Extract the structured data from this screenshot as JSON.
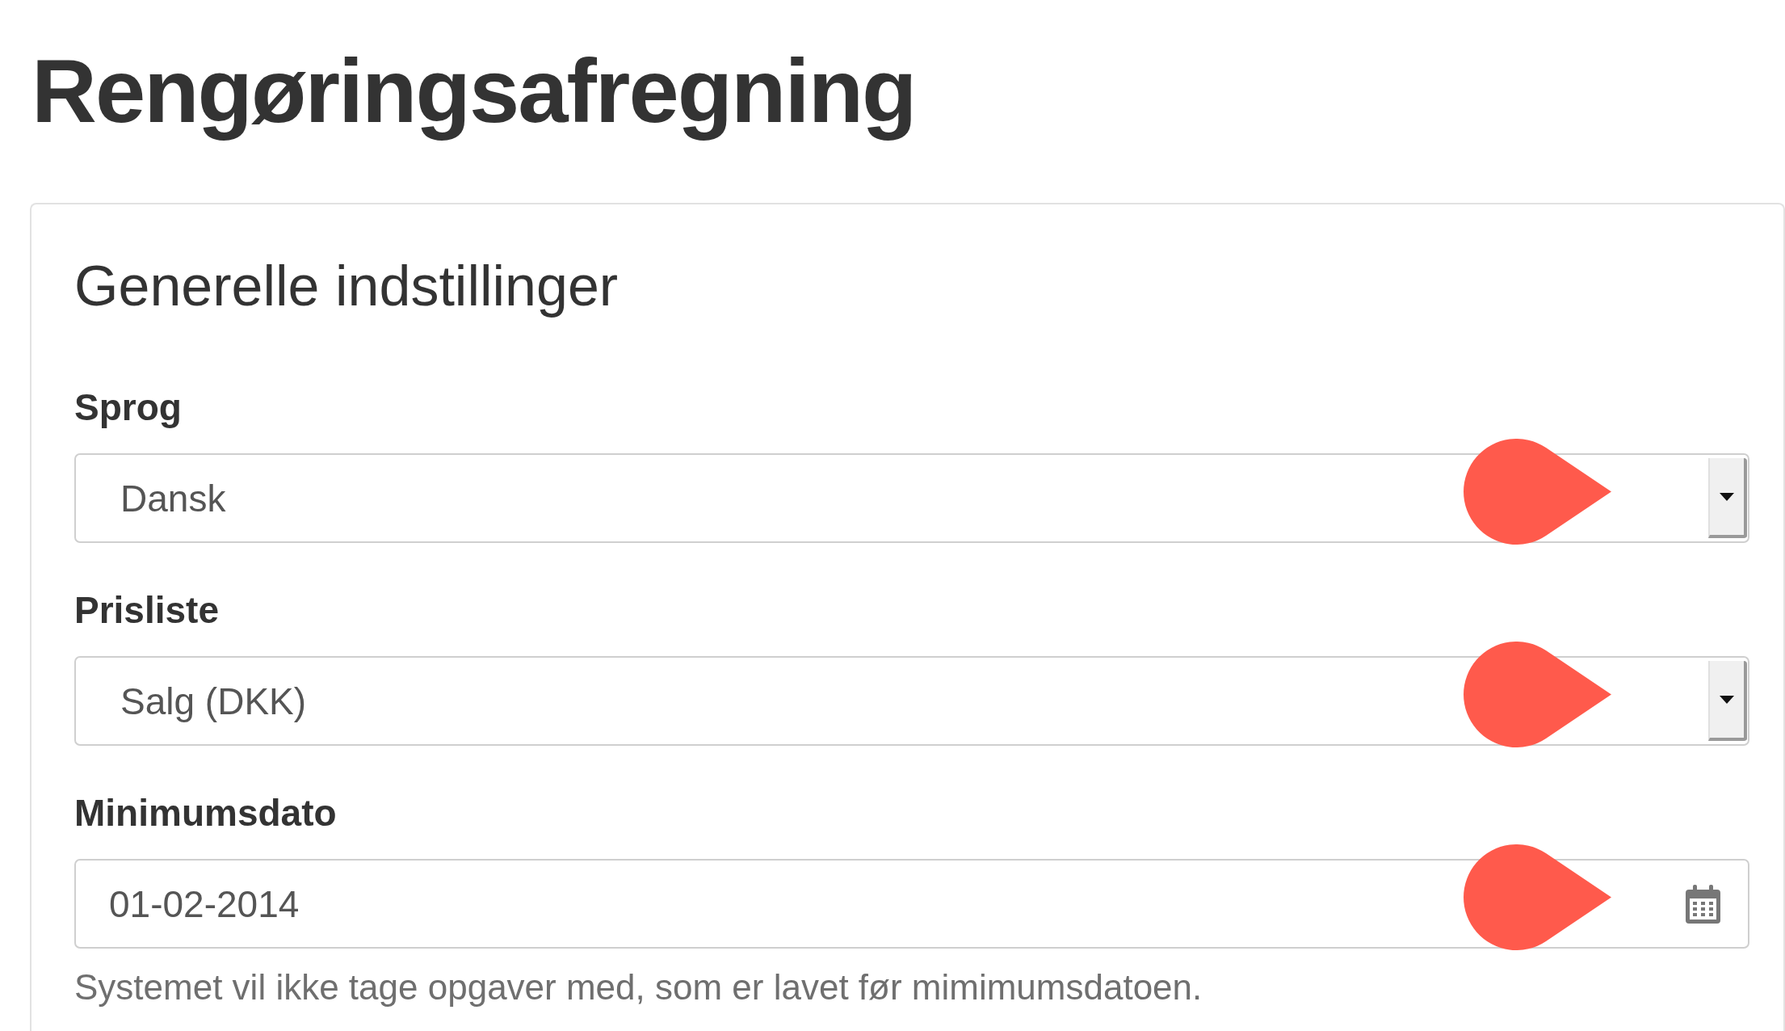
{
  "page_title": "Rengøringsafregning",
  "panel": {
    "title": "Generelle indstillinger",
    "fields": [
      {
        "kind": "select",
        "label": "Sprog",
        "value": "Dansk",
        "marked": true
      },
      {
        "kind": "select",
        "label": "Prisliste",
        "value": "Salg (DKK)",
        "marked": true
      },
      {
        "kind": "date",
        "label": "Minimumsdato",
        "value": "01-02-2014",
        "marked": true,
        "help": "Systemet vil ikke tage opgaver med, som er lavet før mimimumsdatoen."
      }
    ]
  }
}
